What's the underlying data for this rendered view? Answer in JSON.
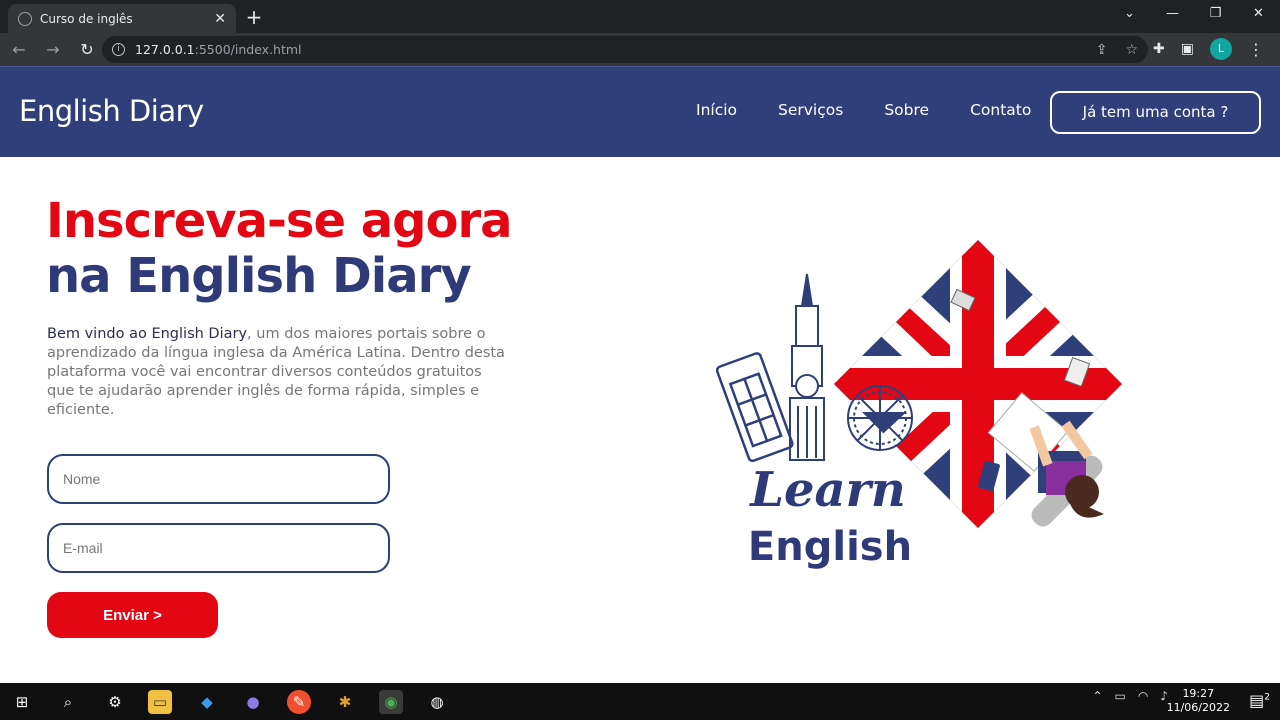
{
  "browser": {
    "tab_title": "Curso de inglês",
    "url_host": "127.0.0.1",
    "url_path": ":5500/index.html",
    "avatar_letter": "L"
  },
  "header": {
    "logo": "English Diary",
    "nav": [
      "Início",
      "Serviços",
      "Sobre",
      "Contato"
    ],
    "account_button": "Já tem uma conta ?"
  },
  "hero": {
    "title_line1": "Inscreva-se agora",
    "title_line2": "na English Diary",
    "intro_strong": "Bem vindo ao English Diary",
    "intro_rest": ", um dos maiores portais sobre o aprendizado da língua inglesa da América Latina. Dentro desta plataforma você vai encontrar diversos conteúdos gratuitos que te ajudarão aprender inglês de forma rápida, simples e eficiente.",
    "name_placeholder": "Nome",
    "email_placeholder": "E-mail",
    "submit_label": "Enviar >"
  },
  "illustration": {
    "word1": "Learn",
    "word2": "English"
  },
  "taskbar": {
    "time": "19:27",
    "date": "11/06/2022",
    "notifications": "2"
  },
  "colors": {
    "brand_blue": "#2f3f7a",
    "brand_red": "#e30613"
  }
}
